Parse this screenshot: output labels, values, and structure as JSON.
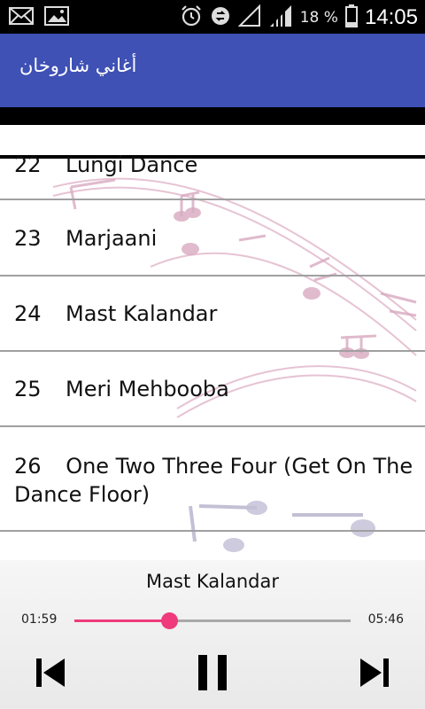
{
  "status": {
    "battery_text": "18 %",
    "time": "14:05"
  },
  "appbar": {
    "title": "أغاني شاروخان"
  },
  "songs": [
    {
      "num": "22",
      "title": "Lungi Dance"
    },
    {
      "num": "23",
      "title": "Marjaani"
    },
    {
      "num": "24",
      "title": "Mast Kalandar"
    },
    {
      "num": "25",
      "title": "Meri Mehbooba"
    },
    {
      "num": "26",
      "title": "One Two Three Four (Get On The",
      "title_line2": "Dance Floor)"
    }
  ],
  "player": {
    "now_playing": "Mast Kalandar",
    "current_time": "01:59",
    "total_time": "05:46",
    "progress_fraction": 0.344,
    "accent_color": "#ef3a7b"
  },
  "icons": {
    "prev": "skip-previous-icon",
    "pause": "pause-icon",
    "next": "skip-next-icon"
  }
}
